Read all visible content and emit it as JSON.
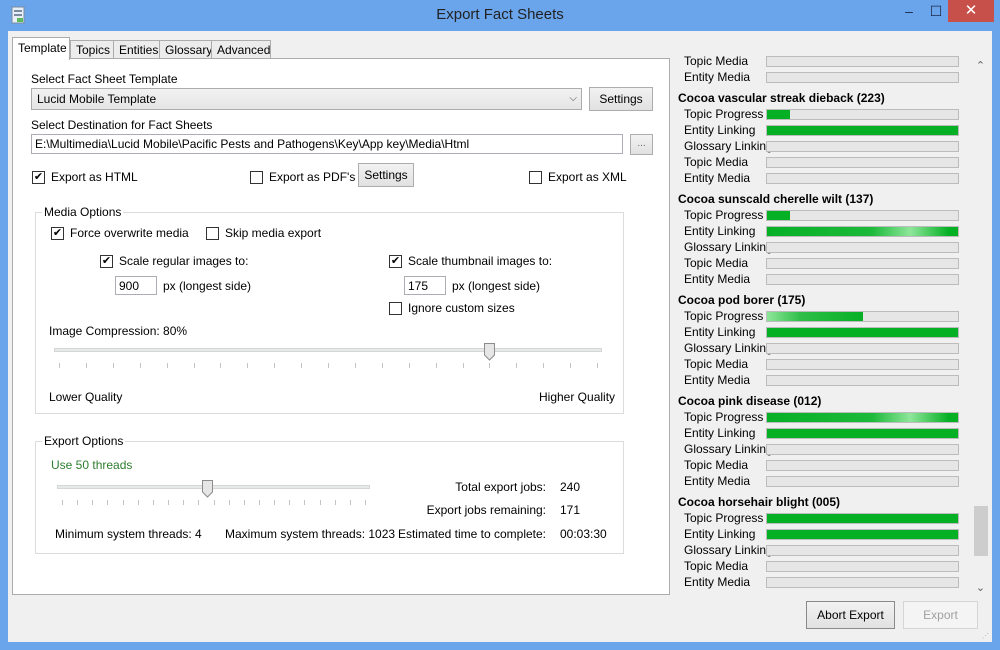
{
  "window": {
    "title": "Export Fact Sheets",
    "controls": {
      "minimize": "‒",
      "maximize": "☐",
      "close": "✕"
    }
  },
  "tabs": [
    {
      "label": "Template",
      "active": true
    },
    {
      "label": "Topics",
      "active": false
    },
    {
      "label": "Entities",
      "active": false
    },
    {
      "label": "Glossary",
      "active": false
    },
    {
      "label": "Advanced",
      "active": false
    }
  ],
  "template": {
    "select_label": "Select Fact Sheet Template",
    "selected_template": "Lucid Mobile Template",
    "settings_label": "Settings",
    "destination_label": "Select Destination for Fact Sheets",
    "destination_path": "E:\\Multimedia\\Lucid Mobile\\Pacific Pests and Pathogens\\Key\\App key\\Media\\Html",
    "browse_label": "...",
    "export_html": {
      "label": "Export as HTML",
      "checked": true
    },
    "export_pdf": {
      "label": "Export as PDF's",
      "checked": false
    },
    "pdf_settings_label": "Settings",
    "export_xml": {
      "label": "Export as XML",
      "checked": false
    }
  },
  "media_options": {
    "title": "Media Options",
    "force_overwrite": {
      "label": "Force overwrite media",
      "checked": true
    },
    "skip_media": {
      "label": "Skip media export",
      "checked": false
    },
    "scale_regular": {
      "label": "Scale regular images to:",
      "checked": true,
      "value": "900",
      "unit": "px (longest side)"
    },
    "scale_thumbnail": {
      "label": "Scale thumbnail images to:",
      "checked": true,
      "value": "175",
      "unit": "px (longest side)"
    },
    "ignore_custom": {
      "label": "Ignore custom sizes",
      "checked": false
    },
    "compression_label": "Image Compression: 80%",
    "compression_value": 0.8,
    "lower_label": "Lower Quality",
    "higher_label": "Higher Quality"
  },
  "export_options": {
    "title": "Export Options",
    "threads_label": "Use 50 threads",
    "threads_fraction": 0.48,
    "min_threads": "Minimum system threads: 4",
    "max_threads": "Maximum system threads: 1023",
    "total_jobs_label": "Total export jobs:",
    "total_jobs": "240",
    "remaining_label": "Export jobs remaining:",
    "remaining": "171",
    "eta_label": "Estimated time to complete:",
    "eta": "00:03:30"
  },
  "progress": {
    "partial_top": [
      {
        "label": "Topic Media",
        "value": 0
      },
      {
        "label": "Entity Media",
        "value": 0
      }
    ],
    "items": [
      {
        "title": "Cocoa vascular streak dieback (223)",
        "bars": [
          {
            "label": "Topic Progress",
            "value": 0.12
          },
          {
            "label": "Entity Linking",
            "value": 1.0
          },
          {
            "label": "Glossary Linking",
            "value": 0
          },
          {
            "label": "Topic Media",
            "value": 0
          },
          {
            "label": "Entity Media",
            "value": 0
          }
        ]
      },
      {
        "title": "Cocoa sunscald cherelle wilt (137)",
        "bars": [
          {
            "label": "Topic Progress",
            "value": 0.12
          },
          {
            "label": "Entity Linking",
            "value": 1.0
          },
          {
            "label": "Glossary Linking",
            "value": 0
          },
          {
            "label": "Topic Media",
            "value": 0
          },
          {
            "label": "Entity Media",
            "value": 0
          }
        ]
      },
      {
        "title": "Cocoa pod borer (175)",
        "bars": [
          {
            "label": "Topic Progress",
            "value": 0.5
          },
          {
            "label": "Entity Linking",
            "value": 1.0
          },
          {
            "label": "Glossary Linking",
            "value": 0
          },
          {
            "label": "Topic Media",
            "value": 0
          },
          {
            "label": "Entity Media",
            "value": 0
          }
        ]
      },
      {
        "title": "Cocoa pink disease (012)",
        "bars": [
          {
            "label": "Topic Progress",
            "value": 1.0
          },
          {
            "label": "Entity Linking",
            "value": 1.0
          },
          {
            "label": "Glossary Linking",
            "value": 0
          },
          {
            "label": "Topic Media",
            "value": 0
          },
          {
            "label": "Entity Media",
            "value": 0
          }
        ]
      },
      {
        "title": "Cocoa horsehair blight (005)",
        "bars": [
          {
            "label": "Topic Progress",
            "value": 1.0
          },
          {
            "label": "Entity Linking",
            "value": 1.0
          },
          {
            "label": "Glossary Linking",
            "value": 0
          },
          {
            "label": "Topic Media",
            "value": 0
          },
          {
            "label": "Entity Media",
            "value": 0
          }
        ]
      }
    ]
  },
  "footer": {
    "abort_label": "Abort Export",
    "export_label": "Export"
  },
  "colors": {
    "progress_green": "#06b025",
    "threads_text": "#2f7d2f",
    "titlebar": "#6aa5ec",
    "close_button": "#c7504b"
  }
}
